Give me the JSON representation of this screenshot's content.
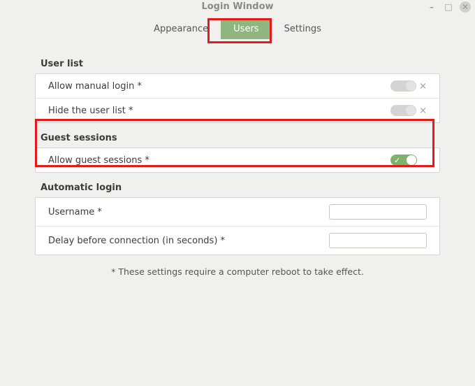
{
  "window": {
    "title": "Login Window"
  },
  "tabs": {
    "appearance": "Appearance",
    "users": "Users",
    "settings": "Settings",
    "active": "users"
  },
  "sections": {
    "user_list": {
      "title": "User list",
      "rows": {
        "allow_manual_login": {
          "label": "Allow manual login *",
          "value": false
        },
        "hide_user_list": {
          "label": "Hide the user list *",
          "value": false
        }
      }
    },
    "guest_sessions": {
      "title": "Guest sessions",
      "rows": {
        "allow_guest_sessions": {
          "label": "Allow guest sessions *",
          "value": true
        }
      }
    },
    "automatic_login": {
      "title": "Automatic login",
      "rows": {
        "username": {
          "label": "Username *",
          "value": ""
        },
        "delay": {
          "label": "Delay before connection (in seconds) *",
          "value": ""
        }
      }
    }
  },
  "footer_note": "* These settings require a computer reboot to take effect.",
  "icons": {
    "x": "×",
    "check": "✓",
    "minimize": "–",
    "maximize": "□",
    "close": "✕"
  }
}
